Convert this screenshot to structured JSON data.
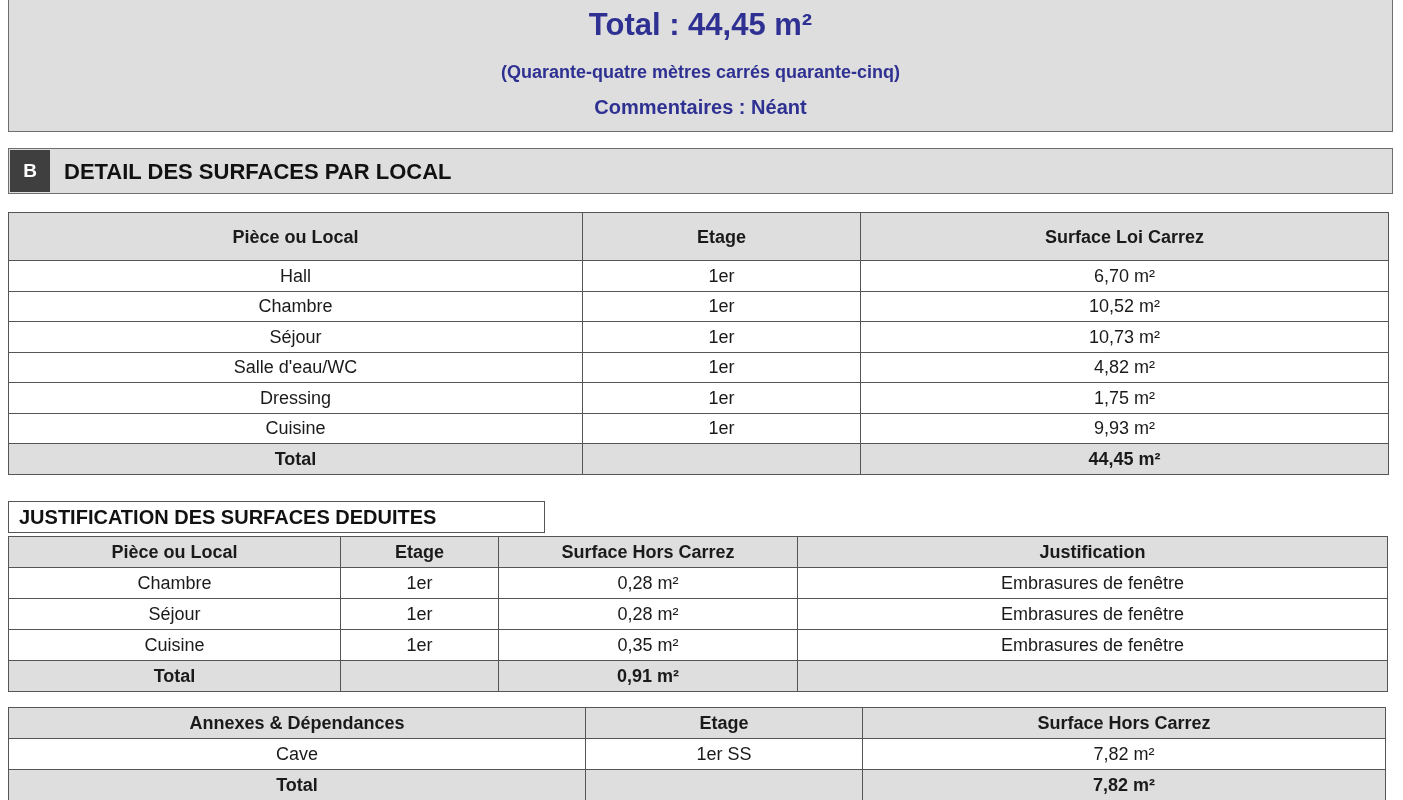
{
  "summary": {
    "total": "Total : 44,45 m²",
    "total_in_words": "(Quarante-quatre mètres carrés quarante-cinq)",
    "comments": "Commentaires : Néant"
  },
  "section": {
    "badge": "B",
    "title": "DETAIL DES SURFACES PAR LOCAL"
  },
  "tables": [
    {
      "columns": [
        "Pièce ou Local",
        "Etage",
        "Surface Loi Carrez"
      ],
      "rows": [
        {
          "kind": "item",
          "cells": [
            "Hall",
            "1er",
            "6,70 m²"
          ]
        },
        {
          "kind": "item",
          "cells": [
            "Chambre",
            "1er",
            "10,52 m²"
          ]
        },
        {
          "kind": "item",
          "cells": [
            "Séjour",
            "1er",
            "10,73 m²"
          ]
        },
        {
          "kind": "item",
          "cells": [
            "Salle d'eau/WC",
            "1er",
            "4,82 m²"
          ]
        },
        {
          "kind": "item",
          "cells": [
            "Dressing",
            "1er",
            "1,75 m²"
          ]
        },
        {
          "kind": "item",
          "cells": [
            "Cuisine",
            "1er",
            "9,93 m²"
          ]
        },
        {
          "kind": "total",
          "label": "Total",
          "value": "44,45 m²"
        }
      ]
    },
    {
      "title": "JUSTIFICATION DES SURFACES DEDUITES",
      "columns": [
        "Pièce ou Local",
        "Etage",
        "Surface Hors Carrez",
        "Justification"
      ],
      "rows": [
        {
          "kind": "item",
          "cells": [
            "Chambre",
            "1er",
            "0,28 m²",
            "Embrasures de fenêtre"
          ]
        },
        {
          "kind": "item",
          "cells": [
            "Séjour",
            "1er",
            "0,28 m²",
            "Embrasures de fenêtre"
          ]
        },
        {
          "kind": "item",
          "cells": [
            "Cuisine",
            "1er",
            "0,35 m²",
            "Embrasures de fenêtre"
          ]
        },
        {
          "kind": "total",
          "label": "Total",
          "value": "0,91 m²"
        }
      ]
    },
    {
      "columns": [
        "Annexes & Dépendances",
        "Etage",
        "Surface Hors Carrez"
      ],
      "rows": [
        {
          "kind": "item",
          "cells": [
            "Cave",
            "1er SS",
            "7,82 m²"
          ]
        },
        {
          "kind": "total",
          "label": "Total",
          "value": "7,82 m²"
        }
      ]
    }
  ]
}
